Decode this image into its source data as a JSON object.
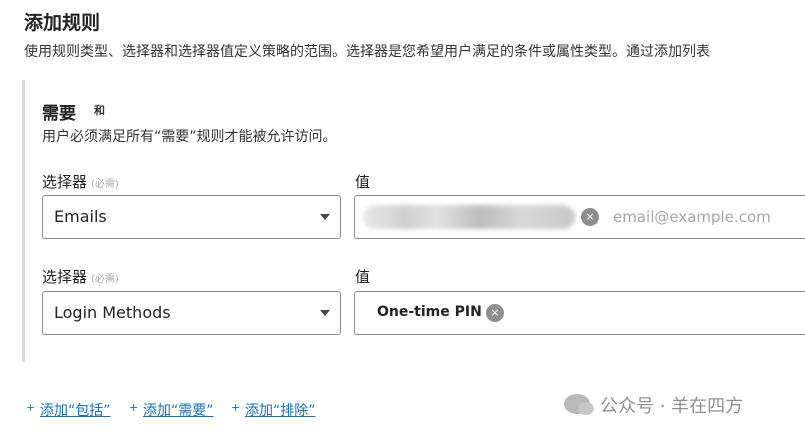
{
  "page": {
    "title": "添加规则",
    "description": "使用规则类型、选择器和选择器值定义策略的范围。选择器是您希望用户满足的条件或属性类型。通过添加列表"
  },
  "section": {
    "title": "需要",
    "badge": "和",
    "description": "用户必须满足所有“需要”规则才能被允许访问。"
  },
  "rules": [
    {
      "selector_label": "选择器",
      "selector_hint": "(必需)",
      "selector_value": "Emails",
      "value_label": "值",
      "value_placeholder": "email@example.com",
      "remove_symbol": "×"
    },
    {
      "selector_label": "选择器",
      "selector_hint": "(必需)",
      "selector_value": "Login Methods",
      "value_label": "值",
      "chip": "One-time PIN",
      "remove_symbol": "×"
    }
  ],
  "actions": {
    "plus_symbol": "+",
    "add_include": "添加“包括”",
    "add_require": "添加“需要”",
    "add_exclude": "添加“排除”"
  },
  "watermark": {
    "text": "公众号 · 羊在四方"
  }
}
